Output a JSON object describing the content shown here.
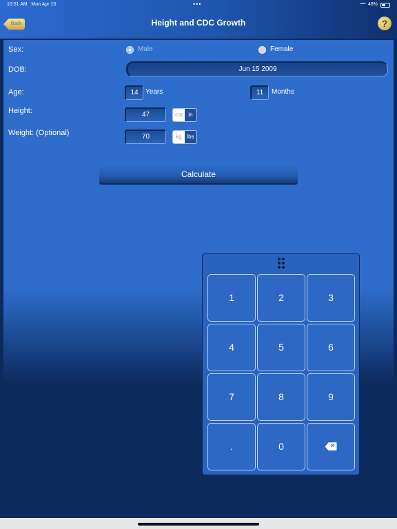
{
  "status_bar": {
    "time": "10:51 AM",
    "date": "Mon Apr 15",
    "dots": "•••",
    "battery_percent": "48%",
    "battery_level": 0.48
  },
  "nav": {
    "back_label": "Back",
    "title": "Height and CDC Growth",
    "help_label": "?"
  },
  "form": {
    "sex_label": "Sex:",
    "male_label": "Male",
    "female_label": "Female",
    "selected_sex": "Male",
    "dob_label": "DOB:",
    "dob_value": "Jun 15  2009",
    "age_label": "Age:",
    "age_years": "14",
    "years_label": "Years",
    "age_months": "11",
    "months_label": "Months",
    "height_label": "Height:",
    "height_value": "47",
    "height_unit_cm": "cm",
    "height_unit_in": "in",
    "height_unit_selected": "in",
    "weight_label": "Weight: (Optional)",
    "weight_value": "70",
    "weight_unit_kg": "kg",
    "weight_unit_lbs": "lbs",
    "weight_unit_selected": "lbs",
    "calculate_label": "Calculate"
  },
  "keypad": {
    "keys": [
      "1",
      "2",
      "3",
      "4",
      "5",
      "6",
      "7",
      "8",
      "9",
      ".",
      "0"
    ],
    "backspace_icon": "backspace-icon"
  },
  "colors": {
    "panel_blue": "#2e6dcb",
    "deep_navy": "#0d2a5c",
    "accent_gold": "#c9a640"
  }
}
